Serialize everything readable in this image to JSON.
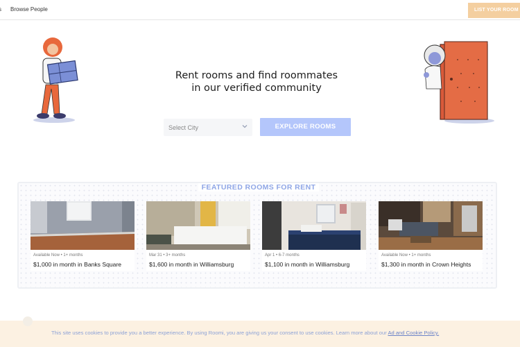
{
  "nav": {
    "cut_link": "s",
    "browse_people": "Browse People",
    "list_room_button": "LIST YOUR ROOM"
  },
  "hero": {
    "headline_line1": "Rent rooms and find roommates",
    "headline_line2": "in our verified community",
    "city_select": "Select City",
    "explore_button": "EXPLORE ROOMS"
  },
  "featured": {
    "title": "FEATURED ROOMS FOR RENT",
    "rooms": [
      {
        "availability": "Available Now • 1+ months",
        "title": "$1,000 in month in Banks Square"
      },
      {
        "availability": "Mar 31 • 3+ months",
        "title": "$1,600 in month in Williamsburg"
      },
      {
        "availability": "Apr 1 • 6-7 months",
        "title": "$1,100 in month in Williamsburg"
      },
      {
        "availability": "Available Now • 1+ months",
        "title": "$1,300 in month in Crown Heights"
      }
    ]
  },
  "cookie": {
    "text": "This site uses cookies to provide you a better experience. By using Roomi, you are giving us your consent to use cookies. Learn more about our",
    "link": "Ad and Cookie Policy."
  },
  "colors": {
    "accent_blue": "#b4c6fb",
    "title_blue": "#8fa6e6",
    "list_button": "#f4cfa0",
    "cookie_bg": "#fcf1e2"
  }
}
